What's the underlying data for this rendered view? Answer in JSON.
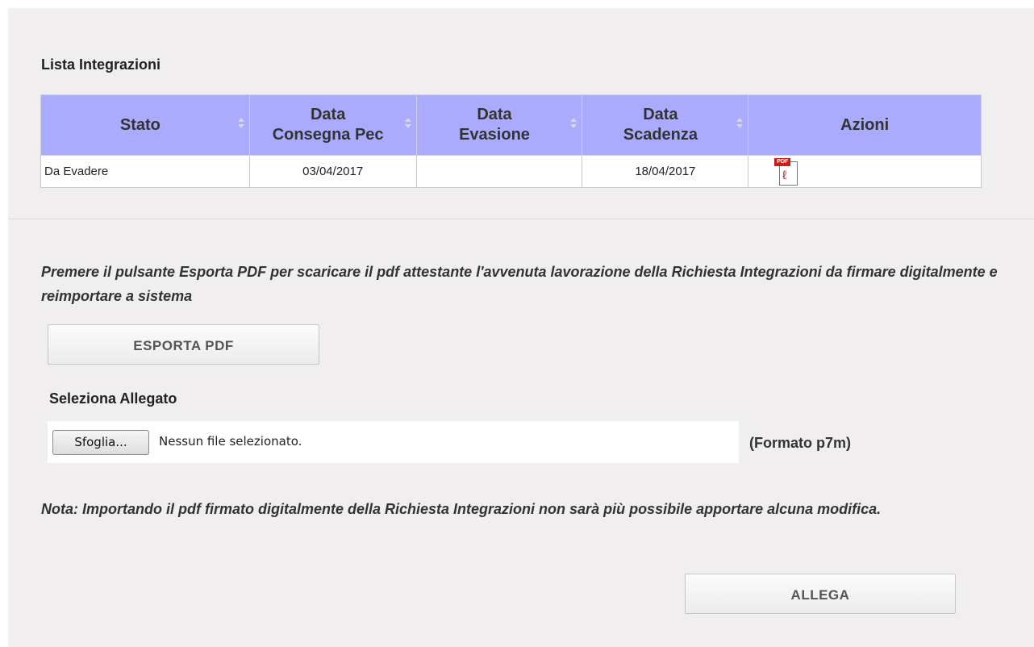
{
  "section": {
    "title": "Lista Integrazioni"
  },
  "table": {
    "headers": [
      {
        "line1": "Stato",
        "line2": ""
      },
      {
        "line1": "Data",
        "line2": "Consegna Pec"
      },
      {
        "line1": "Data",
        "line2": "Evasione"
      },
      {
        "line1": "Data",
        "line2": "Scadenza"
      },
      {
        "line1": "Azioni",
        "line2": ""
      }
    ],
    "rows": [
      {
        "stato": "Da Evadere",
        "consegna": "03/04/2017",
        "evasione": "",
        "scadenza": "18/04/2017",
        "azione_icon": "pdf-icon",
        "pdf_tag": "PDF"
      }
    ]
  },
  "export": {
    "instructions": "Premere il pulsante Esporta PDF per scaricare il pdf attestante l'avvenuta lavorazione della Richiesta Integrazioni da firmare digitalmente e reimportare a sistema",
    "button_label": "ESPORTA PDF"
  },
  "attachment": {
    "label": "Seleziona Allegato",
    "browse_label": "Sfoglia...",
    "file_status": "Nessun file selezionato.",
    "format_hint": "(Formato p7m)",
    "note": "Nota: Importando il pdf firmato digitalmente della Richiesta Integrazioni non sarà più possibile apportare alcuna modifica.",
    "submit_label": "ALLEGA"
  },
  "colors": {
    "header_bg": "#aaaaff",
    "panel_bg": "#f0eeee",
    "pdf_red": "#c81e1e"
  }
}
